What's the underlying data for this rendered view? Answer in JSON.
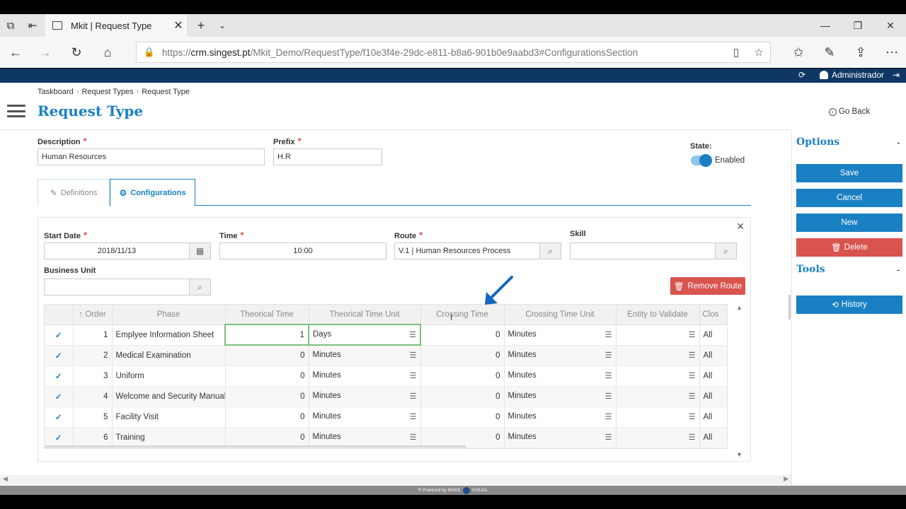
{
  "browser": {
    "tab_title": "Mkit | Request Type",
    "url_prefix": "https://",
    "url_host": "crm.singest.pt",
    "url_path": "/Mkit_Demo/RequestType/f10e3f4e-29dc-e811-b8a6-901b0e9aabd3#ConfigurationsSection"
  },
  "header": {
    "user": "Administrador"
  },
  "breadcrumb": [
    "Taskboard",
    "Request Types",
    "Request Type"
  ],
  "page_title": "Request Type",
  "go_back": "Go Back",
  "form": {
    "description_label": "Description",
    "description_value": "Human Resources",
    "prefix_label": "Prefix",
    "prefix_value": "H.R",
    "state_label": "State:",
    "state_value": "Enabled"
  },
  "tabs": [
    {
      "label": "Definitions"
    },
    {
      "label": "Configurations"
    }
  ],
  "config": {
    "start_date_label": "Start Date",
    "start_date_value": "2018/11/13",
    "time_label": "Time",
    "time_value": "10:00",
    "route_label": "Route",
    "route_value": "V.1 | Human Resources Process",
    "skill_label": "Skill",
    "skill_value": "",
    "business_unit_label": "Business Unit",
    "business_unit_value": "",
    "remove_route": "Remove Route"
  },
  "grid": {
    "columns": [
      "Order",
      "Phase",
      "Theorical Time",
      "Theorical Time Unit",
      "Crossing Time",
      "Crossing Time Unit",
      "Entity to Validate",
      "Clos"
    ],
    "rows": [
      {
        "order": "1",
        "phase": "Emplyee Information Sheet",
        "ttime": "1",
        "tunit": "Days",
        "ctime": "0",
        "cunit": "Minutes",
        "entity": "",
        "close": "All"
      },
      {
        "order": "2",
        "phase": "Medical Examination",
        "ttime": "0",
        "tunit": "Minutes",
        "ctime": "0",
        "cunit": "Minutes",
        "entity": "",
        "close": "All"
      },
      {
        "order": "3",
        "phase": "Uniform",
        "ttime": "0",
        "tunit": "Minutes",
        "ctime": "0",
        "cunit": "Minutes",
        "entity": "",
        "close": "All"
      },
      {
        "order": "4",
        "phase": "Welcome and Security Manual",
        "ttime": "0",
        "tunit": "Minutes",
        "ctime": "0",
        "cunit": "Minutes",
        "entity": "",
        "close": "All"
      },
      {
        "order": "5",
        "phase": "Facility Visit",
        "ttime": "0",
        "tunit": "Minutes",
        "ctime": "0",
        "cunit": "Minutes",
        "entity": "",
        "close": "All"
      },
      {
        "order": "6",
        "phase": "Training",
        "ttime": "0",
        "tunit": "Minutes",
        "ctime": "0",
        "cunit": "Minutes",
        "entity": "",
        "close": "All"
      }
    ]
  },
  "options": {
    "title": "Options",
    "save": "Save",
    "cancel": "Cancel",
    "new": "New",
    "delete": "Delete"
  },
  "tools": {
    "title": "Tools",
    "history": "History"
  },
  "footer": {
    "powered_by": "© Powered by MAKE",
    "brand": "VISUAL"
  },
  "colors": {
    "accent": "#1a80c4",
    "danger": "#d9534f",
    "app_header": "#0e3766"
  }
}
